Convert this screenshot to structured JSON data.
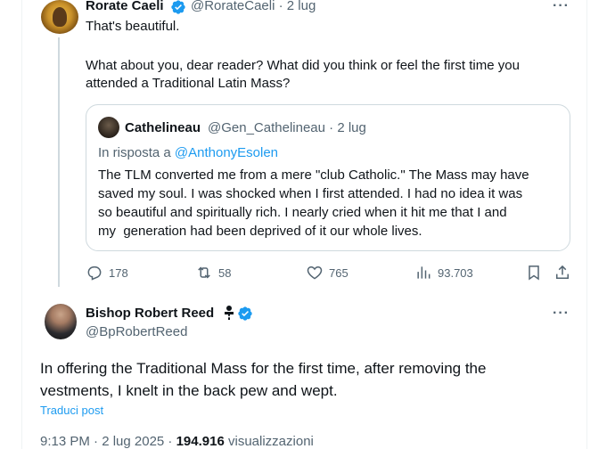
{
  "tweet1": {
    "name": "Rorate Caeli",
    "handle": "@RorateCaeli",
    "separator": "·",
    "date": "2 lug",
    "text_line1": "That's beautiful.",
    "text_line2": "What about you, dear reader? What did you think or feel the first time you",
    "text_line3": "attended a Traditional Latin Mass?",
    "more": "···"
  },
  "quote": {
    "name": "Cathelineau",
    "handle": "@Gen_Cathelineau",
    "separator": "·",
    "date": "2 lug",
    "reply_prefix": "In risposta a ",
    "reply_handle": "@AnthonyEsolen",
    "line1": "The TLM converted me from a mere \"club Catholic.\" The Mass may have",
    "line2": "saved my soul. I was shocked when I first attended. I had no idea it was",
    "line3": "so beautiful and spiritually rich. I nearly cried when it hit me that I and",
    "line4": "my  generation had been deprived of it our whole lives."
  },
  "actions": {
    "replies": "178",
    "reposts": "58",
    "likes": "765",
    "views": "93.703"
  },
  "tweet2": {
    "name": "Bishop Robert Reed",
    "handle": "@BpRobertReed",
    "more": "···",
    "text_line1": "In offering the Traditional Mass for the first time, after removing the",
    "text_line2": "vestments, I knelt in the back pew and wept.",
    "translate": "Traduci post",
    "time": "9:13 PM · 2 lug 2025 · ",
    "views_count": "194.916",
    "views_label": " visualizzazioni"
  },
  "colors": {
    "accent": "#1d9bf0",
    "secondary_text": "#536471",
    "border": "#cfd9de"
  },
  "icons": [
    "verified-badge-icon",
    "more-icon",
    "reply-icon",
    "repost-icon",
    "like-icon",
    "views-icon",
    "bookmark-icon",
    "share-icon",
    "clergy-emoji-icon"
  ]
}
